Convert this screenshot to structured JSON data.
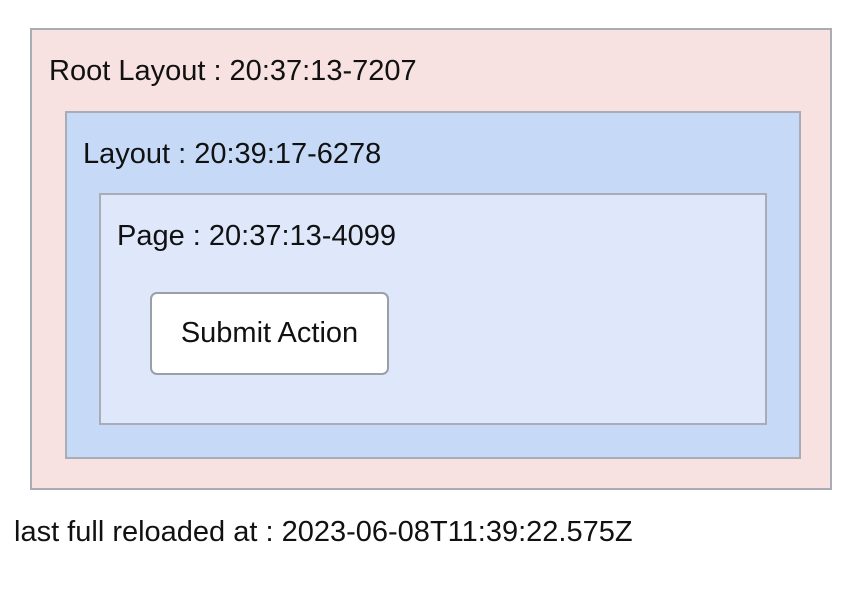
{
  "root_layout": {
    "label": "Root Layout : 20:37:13-7207",
    "background_color": "#f7e1e1"
  },
  "layout": {
    "label": "Layout : 20:39:17-6278",
    "background_color": "#c6daf8"
  },
  "page": {
    "label": "Page : 20:37:13-4099",
    "background_color": "#dfe8fb",
    "submit_label": "Submit Action"
  },
  "footer": {
    "reload_text": "last full reloaded at : 2023-06-08T11:39:22.575Z"
  }
}
